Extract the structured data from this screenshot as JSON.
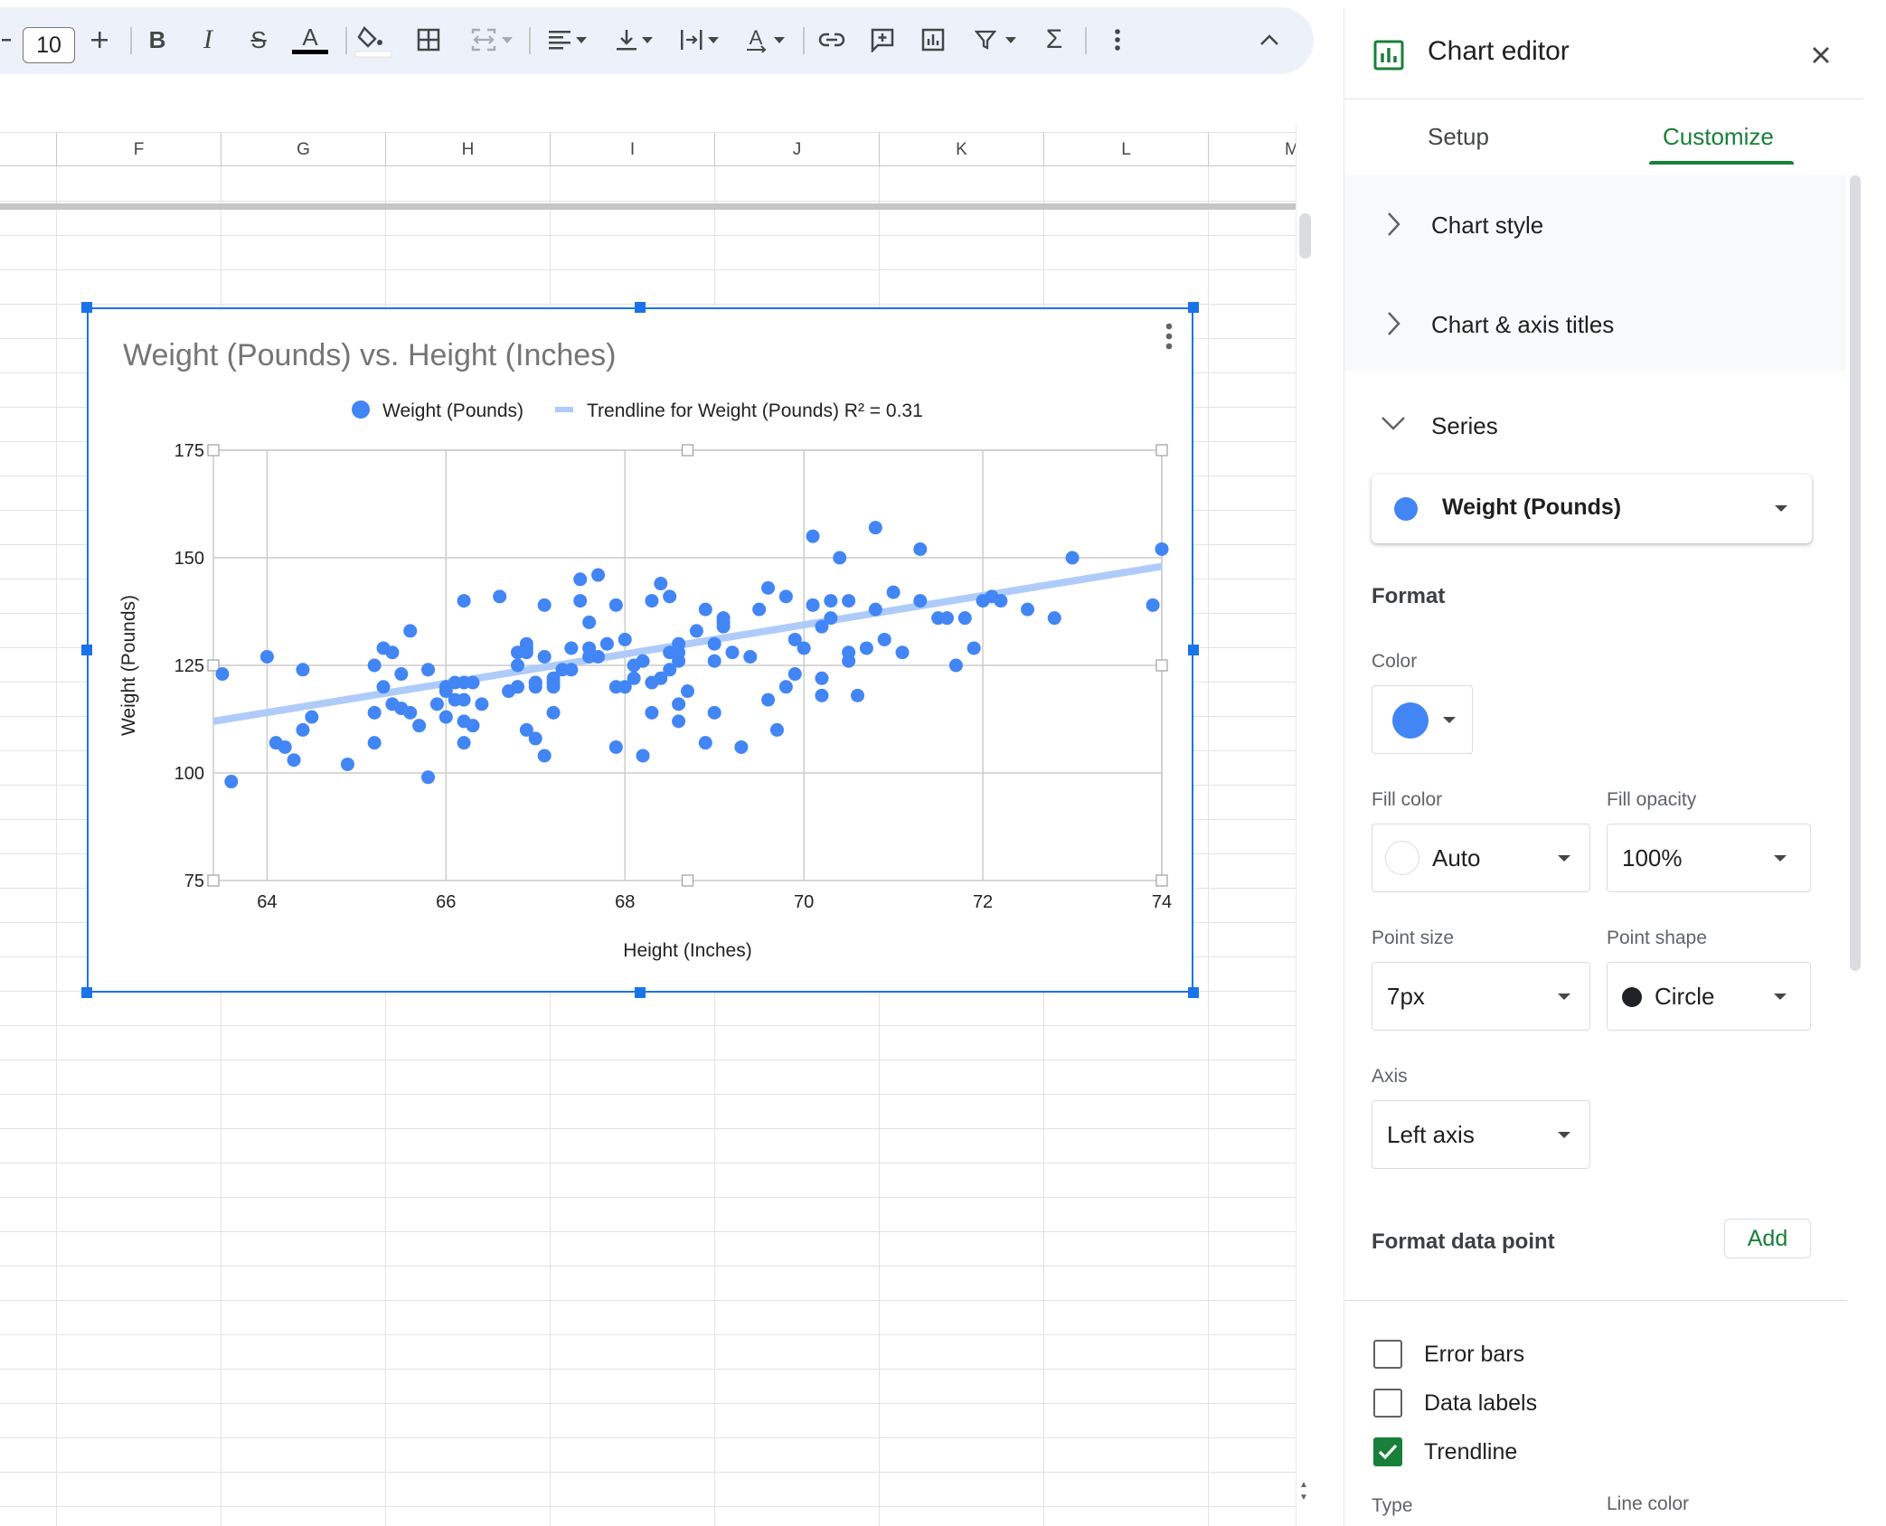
{
  "toolbar": {
    "font_size": "10",
    "items": [
      "minus-icon",
      "plus-icon",
      "bold-icon",
      "italic-icon",
      "strikethrough-icon",
      "text-color-icon",
      "fill-color-icon",
      "borders-icon",
      "merge-cells-icon",
      "align-horizontal-icon",
      "align-vertical-icon",
      "text-wrap-icon",
      "text-rotation-icon",
      "link-icon",
      "comment-icon",
      "chart-icon",
      "filter-icon",
      "functions-icon",
      "more-icon",
      "collapse-icon"
    ]
  },
  "sheet": {
    "columns": [
      "F",
      "G",
      "H",
      "I",
      "J",
      "K",
      "L",
      "M"
    ]
  },
  "chart": {
    "menu_icon": "more-vert-icon"
  },
  "chart_data": {
    "type": "scatter",
    "title": "Weight (Pounds) vs. Height (Inches)",
    "xlabel": "Height (Inches)",
    "ylabel": "Weight (Pounds)",
    "xlim": [
      63.4,
      74
    ],
    "ylim": [
      75,
      175
    ],
    "xticks": [
      "64",
      "66",
      "68",
      "70",
      "72",
      "74"
    ],
    "yticks": [
      "75",
      "100",
      "125",
      "150",
      "175"
    ],
    "grid": true,
    "legend_position": "top",
    "series": [
      {
        "name": "Weight (Pounds)",
        "color": "#4285f4",
        "points": [
          [
            63.5,
            123
          ],
          [
            63.6,
            98
          ],
          [
            64.0,
            127
          ],
          [
            64.1,
            107
          ],
          [
            64.2,
            106
          ],
          [
            64.3,
            103
          ],
          [
            64.4,
            110
          ],
          [
            64.4,
            124
          ],
          [
            64.5,
            113
          ],
          [
            64.9,
            102
          ],
          [
            65.2,
            107
          ],
          [
            65.2,
            114
          ],
          [
            65.2,
            125
          ],
          [
            65.3,
            129
          ],
          [
            65.3,
            120
          ],
          [
            65.4,
            128
          ],
          [
            65.4,
            116
          ],
          [
            65.5,
            123
          ],
          [
            65.5,
            115
          ],
          [
            65.6,
            114
          ],
          [
            65.6,
            133
          ],
          [
            65.7,
            111
          ],
          [
            65.8,
            99
          ],
          [
            65.8,
            124
          ],
          [
            65.9,
            116
          ],
          [
            66.0,
            119
          ],
          [
            66.0,
            120
          ],
          [
            66.0,
            113
          ],
          [
            66.1,
            121
          ],
          [
            66.1,
            117
          ],
          [
            66.2,
            117
          ],
          [
            66.2,
            121
          ],
          [
            66.2,
            112
          ],
          [
            66.2,
            107
          ],
          [
            66.2,
            140
          ],
          [
            66.3,
            111
          ],
          [
            66.3,
            121
          ],
          [
            66.4,
            116
          ],
          [
            66.6,
            141
          ],
          [
            66.7,
            119
          ],
          [
            66.8,
            125
          ],
          [
            66.8,
            128
          ],
          [
            66.9,
            130
          ],
          [
            66.8,
            120
          ],
          [
            66.8,
            120
          ],
          [
            66.9,
            129
          ],
          [
            66.9,
            128
          ],
          [
            66.9,
            110
          ],
          [
            67.0,
            121
          ],
          [
            67.0,
            121
          ],
          [
            67.0,
            108
          ],
          [
            67.0,
            120
          ],
          [
            67.1,
            104
          ],
          [
            67.1,
            139
          ],
          [
            67.1,
            127
          ],
          [
            67.2,
            114
          ],
          [
            67.2,
            121
          ],
          [
            67.2,
            122
          ],
          [
            67.2,
            120
          ],
          [
            67.3,
            124
          ],
          [
            67.4,
            124
          ],
          [
            67.4,
            129
          ],
          [
            67.5,
            140
          ],
          [
            67.5,
            145
          ],
          [
            67.6,
            129
          ],
          [
            67.6,
            127
          ],
          [
            67.6,
            135
          ],
          [
            67.7,
            146
          ],
          [
            67.7,
            127
          ],
          [
            67.8,
            130
          ],
          [
            67.9,
            139
          ],
          [
            67.9,
            120
          ],
          [
            67.9,
            106
          ],
          [
            68.0,
            131
          ],
          [
            68.0,
            120
          ],
          [
            68.1,
            125
          ],
          [
            68.1,
            122
          ],
          [
            68.2,
            104
          ],
          [
            68.2,
            126
          ],
          [
            68.3,
            140
          ],
          [
            68.3,
            121
          ],
          [
            68.3,
            114
          ],
          [
            68.4,
            144
          ],
          [
            68.4,
            122
          ],
          [
            68.5,
            124
          ],
          [
            68.5,
            128
          ],
          [
            68.5,
            141
          ],
          [
            68.6,
            128
          ],
          [
            68.6,
            116
          ],
          [
            68.6,
            126
          ],
          [
            68.6,
            112
          ],
          [
            68.6,
            130
          ],
          [
            68.7,
            119
          ],
          [
            68.8,
            133
          ],
          [
            68.9,
            138
          ],
          [
            68.9,
            107
          ],
          [
            69.0,
            114
          ],
          [
            69.0,
            126
          ],
          [
            69.0,
            130
          ],
          [
            69.1,
            135
          ],
          [
            69.1,
            136
          ],
          [
            69.1,
            134
          ],
          [
            69.2,
            128
          ],
          [
            69.3,
            106
          ],
          [
            69.4,
            127
          ],
          [
            69.5,
            138
          ],
          [
            69.6,
            117
          ],
          [
            69.6,
            143
          ],
          [
            69.7,
            110
          ],
          [
            69.8,
            120
          ],
          [
            69.8,
            141
          ],
          [
            69.9,
            123
          ],
          [
            69.9,
            131
          ],
          [
            70.0,
            129
          ],
          [
            70.1,
            155
          ],
          [
            70.1,
            139
          ],
          [
            70.2,
            134
          ],
          [
            70.2,
            122
          ],
          [
            70.2,
            118
          ],
          [
            70.3,
            136
          ],
          [
            70.3,
            140
          ],
          [
            70.4,
            150
          ],
          [
            70.5,
            140
          ],
          [
            70.5,
            126
          ],
          [
            70.5,
            128
          ],
          [
            70.6,
            118
          ],
          [
            70.7,
            129
          ],
          [
            70.8,
            157
          ],
          [
            70.8,
            138
          ],
          [
            70.9,
            131
          ],
          [
            71.0,
            142
          ],
          [
            71.1,
            128
          ],
          [
            71.3,
            152
          ],
          [
            71.3,
            140
          ],
          [
            71.5,
            136
          ],
          [
            71.6,
            136
          ],
          [
            71.7,
            125
          ],
          [
            71.8,
            136
          ],
          [
            71.9,
            129
          ],
          [
            72.0,
            140
          ],
          [
            72.1,
            141
          ],
          [
            72.2,
            140
          ],
          [
            72.5,
            138
          ],
          [
            72.8,
            136
          ],
          [
            73.0,
            150
          ],
          [
            73.9,
            139
          ],
          [
            74.0,
            152
          ]
        ]
      }
    ],
    "trendline": {
      "name": "Trendline for Weight (Pounds) R² = 0.31",
      "color": "#aecbfa",
      "start": [
        63.4,
        112
      ],
      "end": [
        74,
        148
      ]
    }
  },
  "panel": {
    "title": "Chart editor",
    "title_icon": "chart-editor-icon",
    "tabs": [
      "Setup",
      "Customize"
    ],
    "active_tab": "Customize",
    "accordions": [
      "Chart style",
      "Chart & axis titles",
      "Series"
    ],
    "series_select": "Weight (Pounds)",
    "format_label": "Format",
    "color_label": "Color",
    "series_color": "#4285f4",
    "fill_color_label": "Fill color",
    "fill_color_value": "Auto",
    "fill_opacity_label": "Fill opacity",
    "fill_opacity_value": "100%",
    "point_size_label": "Point size",
    "point_size_value": "7px",
    "point_shape_label": "Point shape",
    "point_shape_value": "Circle",
    "axis_label": "Axis",
    "axis_value": "Left axis",
    "format_point_label": "Format data point",
    "add_label": "Add",
    "checkboxes": [
      {
        "label": "Error bars",
        "checked": false
      },
      {
        "label": "Data labels",
        "checked": false
      },
      {
        "label": "Trendline",
        "checked": true
      }
    ],
    "type_label": "Type",
    "line_color_label": "Line color"
  }
}
